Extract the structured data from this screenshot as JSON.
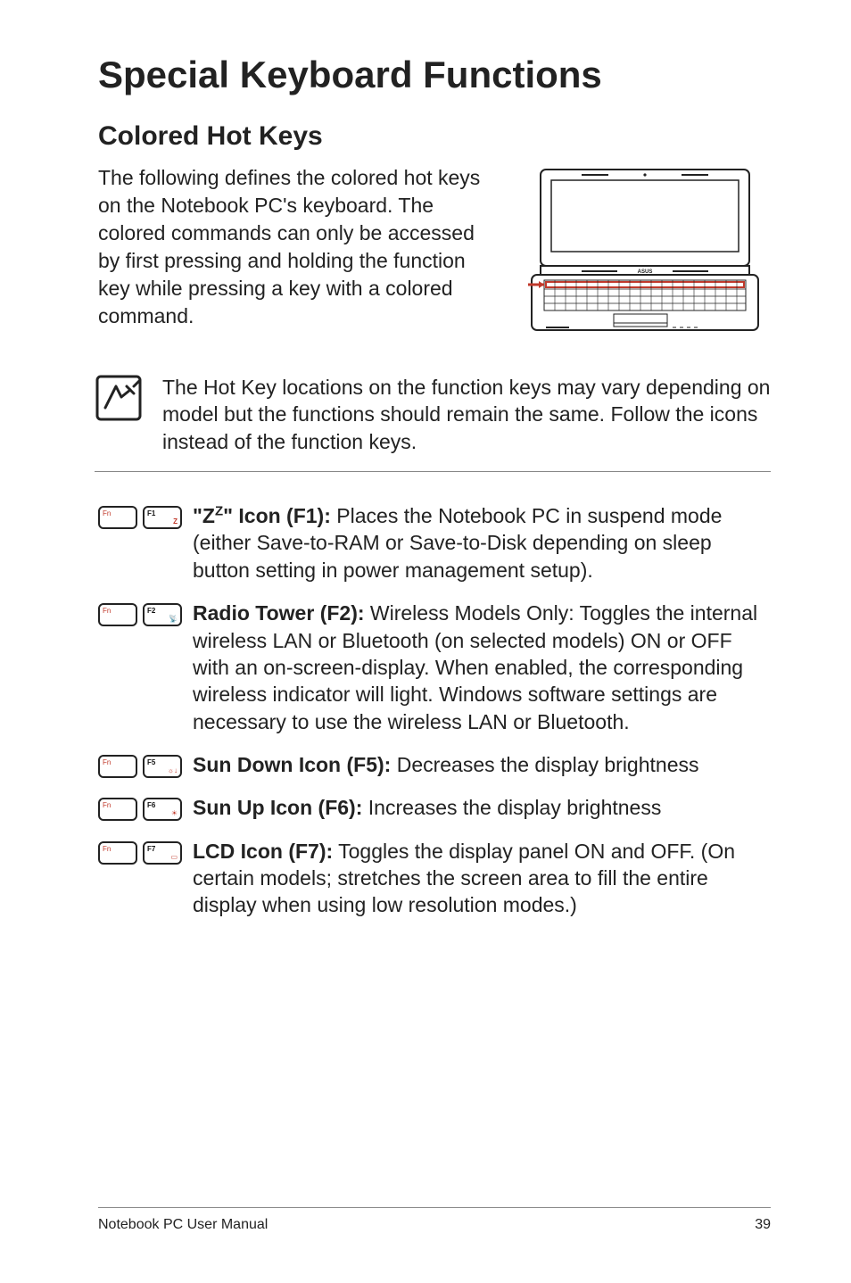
{
  "heading": "Special Keyboard Functions",
  "subheading": "Colored Hot Keys",
  "intro": "The following defines the colored hot keys on the Notebook PC's keyboard. The colored commands can only be accessed by first pressing and holding the function key while pressing a key with a colored command.",
  "note": "The Hot Key locations on the function keys may vary depending on model but the functions should remain the same. Follow the icons instead of the function keys.",
  "rows": [
    {
      "key1_label": "Fn",
      "key2_label": "F1",
      "key2_glyph": "Z",
      "title_html": "\"Z<sup>Z</sup>\" Icon (F1):",
      "body": " Places the Notebook PC in suspend mode (either Save-to-RAM or Save-to-Disk depending on sleep button setting in power management setup)."
    },
    {
      "key1_label": "Fn",
      "key2_label": "F2",
      "key2_glyph": "📡",
      "title_html": "Radio Tower (F2):",
      "body": " Wireless Models Only: Toggles the internal wireless LAN or Bluetooth (on selected models) ON or OFF with an on-screen-display. When enabled, the corresponding wireless indicator will light. Windows software settings are necessary to use the wireless LAN or Bluetooth."
    },
    {
      "key1_label": "Fn",
      "key2_label": "F5",
      "key2_glyph": "☼↓",
      "title_html": "Sun Down Icon (F5):",
      "body": " Decreases the display brightness"
    },
    {
      "key1_label": "Fn",
      "key2_label": "F6",
      "key2_glyph": "☀",
      "title_html": "Sun Up Icon (F6):",
      "body": " Increases the display brightness"
    },
    {
      "key1_label": "Fn",
      "key2_label": "F7",
      "key2_glyph": "▭",
      "title_html": "LCD Icon (F7):",
      "body": " Toggles the display panel ON and OFF. (On certain models; stretches the screen area to fill the entire display when using low resolution modes.)"
    }
  ],
  "footer_left": "Notebook PC User Manual",
  "footer_right": "39"
}
